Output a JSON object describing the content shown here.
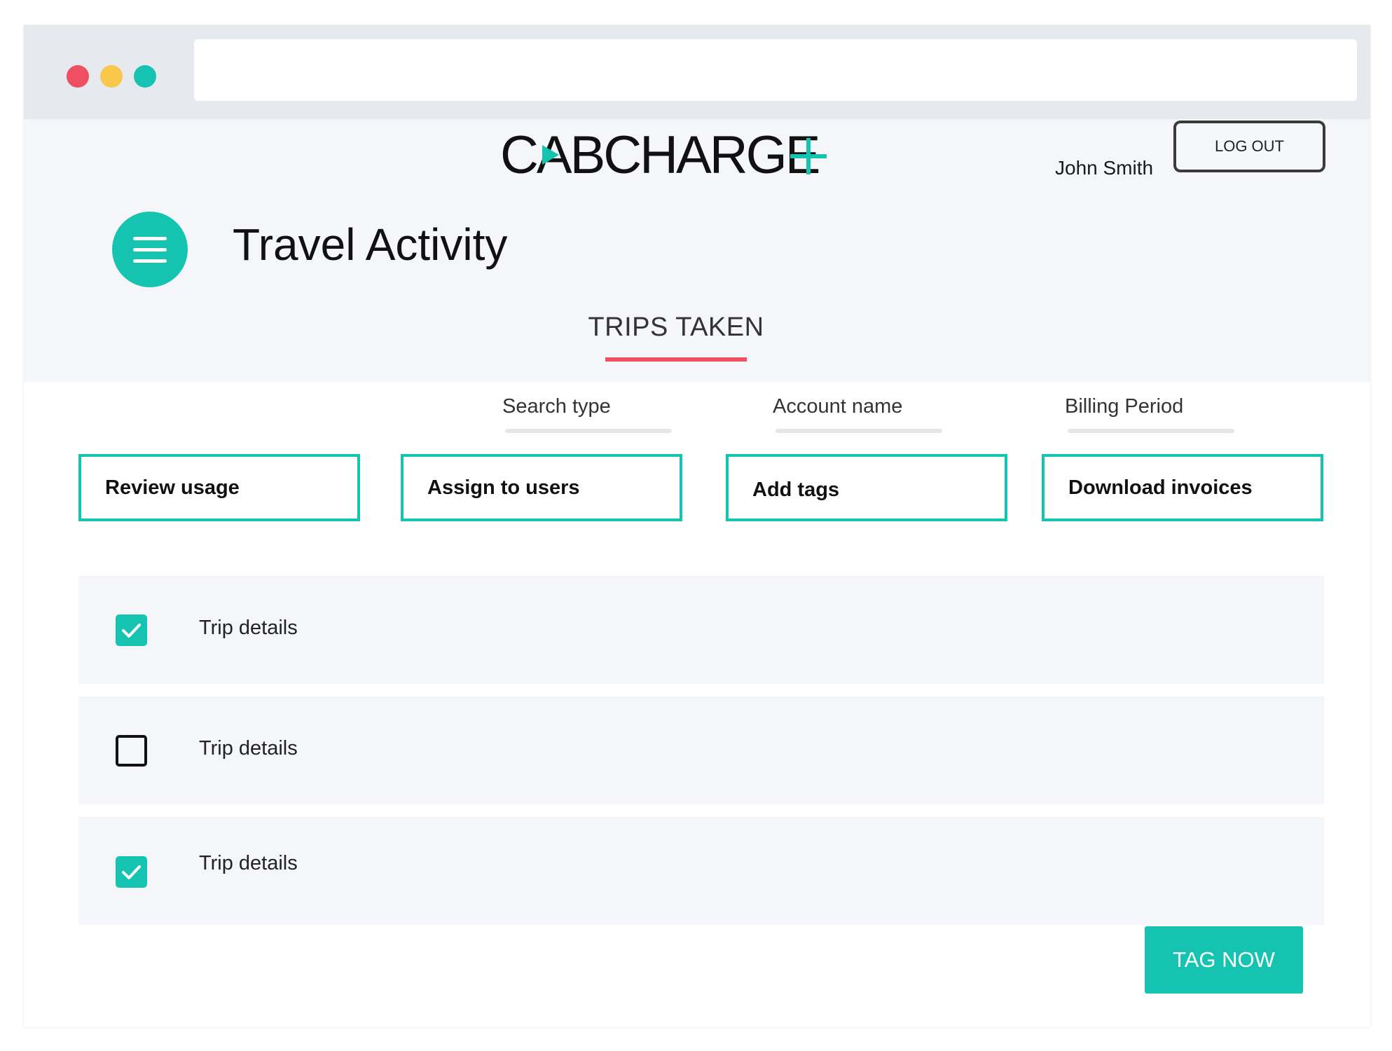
{
  "app": {
    "logo_text": "CABCHARGE",
    "brand_color": "#14c4b0",
    "accent_color": "#ee5061"
  },
  "header": {
    "user_name": "John Smith",
    "logout_label": "LOG OUT",
    "page_title": "Travel Activity",
    "menu_icon": "hamburger-menu-icon"
  },
  "tabs": [
    {
      "label": "TRIPS TAKEN",
      "active": true
    }
  ],
  "filters": [
    {
      "label": "Search type"
    },
    {
      "label": "Account name"
    },
    {
      "label": "Billing Period"
    }
  ],
  "actions": [
    {
      "label": "Review usage"
    },
    {
      "label": "Assign to users"
    },
    {
      "label": "Add tags"
    },
    {
      "label": "Download invoices"
    }
  ],
  "trips": [
    {
      "label": "Trip details",
      "checked": true
    },
    {
      "label": "Trip details",
      "checked": false
    },
    {
      "label": "Trip details",
      "checked": true
    }
  ],
  "footer": {
    "tag_now_label": "TAG NOW"
  }
}
